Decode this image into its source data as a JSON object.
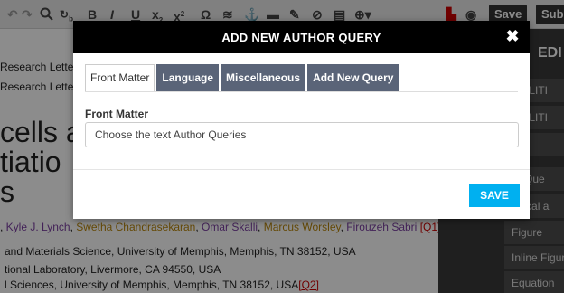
{
  "toolbar": {
    "icons": [
      "search-icon",
      "replace-icon",
      "bold-icon",
      "italic-icon",
      "underline-icon",
      "subscript-icon",
      "superscript-icon",
      "omega-icon",
      "stack-icon",
      "anchor-icon",
      "comment-icon",
      "edit-icon",
      "attach-icon",
      "note-icon",
      "add-icon",
      "pdf-icon",
      "camera-icon"
    ],
    "bold": "B",
    "italic": "I",
    "underline": "U",
    "subscript": "x",
    "superscript": "x",
    "omega": "Ω",
    "save_label": "Save",
    "submit_label": "Sub"
  },
  "document": {
    "running_head_1": "Research Letter",
    "running_head_2": "Research Letter",
    "title_line_1": "cells a",
    "title_line_2": "tiatio",
    "title_line_3": "s",
    "authors": [
      {
        "name": "Kyle J. Lynch",
        "color": "#7a3fa0"
      },
      {
        "name": "Swetha Chandrasekaran",
        "color": "#b8860b"
      },
      {
        "name": "Omar Skalli",
        "color": "#7a3fa0"
      },
      {
        "name": "Marcus Worsley",
        "color": "#b8860b"
      },
      {
        "name": "Firouzeh Sabri",
        "color": "#7a3fa0"
      }
    ],
    "query_1": "[Q1]",
    "query_2": "[Q2]",
    "affiliation_1": "and Materials Science, University of Memphis, Memphis, TN 38152, USA",
    "affiliation_2": "tional Laboratory, Livermore, CA 94550, USA",
    "affiliation_3": "l Sciences, University of Memphis, Memphis, TN 38152, USA"
  },
  "sidebar": {
    "header": "EDI",
    "items": [
      "UTILITI",
      "UTILITI",
      "D",
      "or Que",
      "phical a",
      "Figure",
      "Inline Figur",
      "Equation"
    ]
  },
  "modal": {
    "title": "ADD NEW AUTHOR QUERY",
    "close_symbol": "✖",
    "tabs": [
      {
        "label": "Front Matter",
        "active": true
      },
      {
        "label": "Language",
        "active": false
      },
      {
        "label": "Miscellaneous",
        "active": false
      },
      {
        "label": "Add New Query",
        "active": false
      }
    ],
    "field_label": "Front Matter",
    "field_placeholder": "Choose the text Author Queries",
    "field_value": "",
    "save_label": "SAVE"
  },
  "colors": {
    "accent": "#00b0f0",
    "tab_inactive": "#5a6478",
    "query_red": "#cc0000",
    "overlay": "rgba(0,0,0,0.45)"
  }
}
